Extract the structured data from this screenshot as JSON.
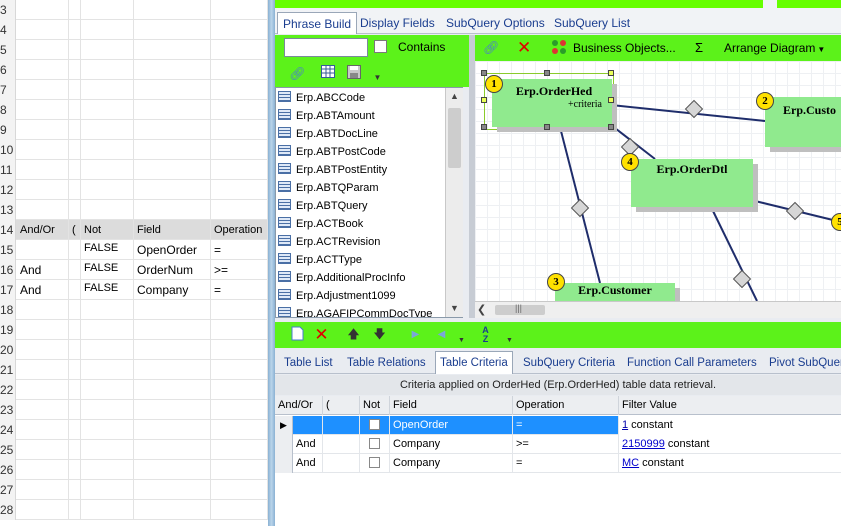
{
  "sheet": {
    "rows": [
      {
        "num": "3"
      },
      {
        "num": "4"
      },
      {
        "num": "5"
      },
      {
        "num": "6"
      },
      {
        "num": "7"
      },
      {
        "num": "8"
      },
      {
        "num": "9"
      },
      {
        "num": "10"
      },
      {
        "num": "11"
      },
      {
        "num": "12"
      },
      {
        "num": "13"
      },
      {
        "num": "14",
        "header": true,
        "a": "And/Or",
        "b": "(",
        "c": "Not",
        "d": "Field",
        "e": "Operation"
      },
      {
        "num": "15",
        "c": "FALSE",
        "d": "OpenOrder",
        "e": "="
      },
      {
        "num": "16",
        "a": "And",
        "c": "FALSE",
        "d": "OrderNum",
        "e": ">="
      },
      {
        "num": "17",
        "a": "And",
        "c": "FALSE",
        "d": "Company",
        "e": "="
      },
      {
        "num": "18"
      },
      {
        "num": "19"
      },
      {
        "num": "20"
      },
      {
        "num": "21"
      },
      {
        "num": "22"
      },
      {
        "num": "23"
      },
      {
        "num": "24"
      },
      {
        "num": "25"
      },
      {
        "num": "26"
      },
      {
        "num": "27"
      },
      {
        "num": "28"
      }
    ]
  },
  "top_tabs": [
    "Phrase Build",
    "Display Fields",
    "SubQuery Options",
    "SubQuery List"
  ],
  "filter": {
    "value": "",
    "contains_label": "Contains"
  },
  "table_list": [
    "Erp.ABCCode",
    "Erp.ABTAmount",
    "Erp.ABTDocLine",
    "Erp.ABTPostCode",
    "Erp.ABTPostEntity",
    "Erp.ABTQParam",
    "Erp.ABTQuery",
    "Erp.ACTBook",
    "Erp.ACTRevision",
    "Erp.ACTType",
    "Erp.AdditionalProcInfo",
    "Erp.Adjustment1099",
    "Erp.AGAFIPCommDocType"
  ],
  "diagram_toolbar": {
    "business_objects": "Business Objects...",
    "sigma": "Σ",
    "arrange": "Arrange Diagram"
  },
  "diagram": {
    "entities": [
      {
        "badge": "1",
        "title": "Erp.OrderHed",
        "sub": "+criteria"
      },
      {
        "badge": "2",
        "title": "Erp.Custo"
      },
      {
        "badge": "4",
        "title": "Erp.OrderDtl"
      },
      {
        "badge": "3",
        "title": "Erp.Customer"
      },
      {
        "badge": "5",
        "title": ""
      }
    ]
  },
  "bottom_tabs": [
    "Table List",
    "Table Relations",
    "Table Criteria",
    "SubQuery Criteria",
    "Function Call Parameters",
    "Pivot SubQuer"
  ],
  "criteria_caption": "Criteria applied on OrderHed (Erp.OrderHed)  table data retrieval.",
  "criteria": {
    "columns": [
      "And/Or",
      "(",
      "Not",
      "Field",
      "Operation",
      "Filter Value"
    ],
    "rows": [
      {
        "andor": "",
        "field": "OpenOrder",
        "op": "=",
        "val_link": "1",
        "val_text": " constant"
      },
      {
        "andor": "And",
        "field": "Company",
        "op": ">=",
        "val_link": "2150999",
        "val_text": " constant"
      },
      {
        "andor": "And",
        "field": "Company",
        "op": "=",
        "val_link": "MC",
        "val_text": " constant"
      }
    ]
  },
  "colors": {
    "toolbar_green": "#5cf21a",
    "entity_green": "#90ea8e",
    "selection": "#1e90ff",
    "badge": "#ffe100"
  }
}
